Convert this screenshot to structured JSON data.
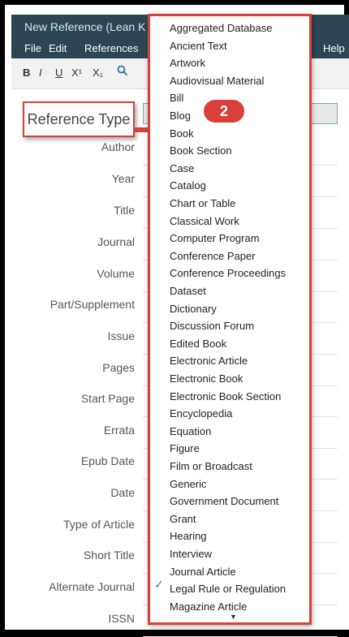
{
  "window": {
    "title": "New Reference (Lean K"
  },
  "menu": {
    "file": "File",
    "edit": "Edit",
    "references": "References",
    "help": "Help"
  },
  "toolbar": {
    "bold": "B",
    "italic": "I",
    "underline": "U",
    "superscript": "X¹",
    "subscript": "X₁"
  },
  "form": {
    "reference_type_label": "Reference Type",
    "fields": [
      "Author",
      "Year",
      "Title",
      "Journal",
      "Volume",
      "Part/Supplement",
      "Issue",
      "Pages",
      "Start Page",
      "Errata",
      "Epub Date",
      "Date",
      "Type of Article",
      "Short Title",
      "Alternate Journal",
      "ISSN"
    ]
  },
  "callout": {
    "number": "2"
  },
  "dropdown": {
    "selected": "Journal Article",
    "options": [
      "Aggregated Database",
      "Ancient Text",
      "Artwork",
      "Audiovisual Material",
      "Bill",
      "Blog",
      "Book",
      "Book Section",
      "Case",
      "Catalog",
      "Chart or Table",
      "Classical Work",
      "Computer Program",
      "Conference Paper",
      "Conference Proceedings",
      "Dataset",
      "Dictionary",
      "Discussion Forum",
      "Edited Book",
      "Electronic Article",
      "Electronic Book",
      "Electronic Book Section",
      "Encyclopedia",
      "Equation",
      "Figure",
      "Film or Broadcast",
      "Generic",
      "Government Document",
      "Grant",
      "Hearing",
      "Interview",
      "Journal Article",
      "Legal Rule or Regulation",
      "Magazine Article"
    ]
  },
  "colors": {
    "titlebar": "#2c4654",
    "highlight": "#d9403a",
    "check": "#3a78c2"
  }
}
